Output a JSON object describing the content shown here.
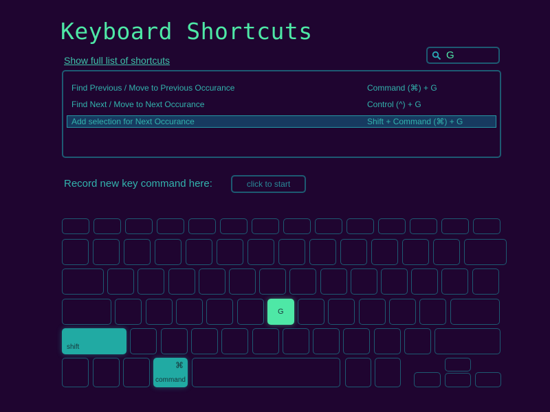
{
  "header": {
    "title": "Keyboard Shortcuts",
    "show_full_list_link": "Show full list of shortcuts"
  },
  "search": {
    "icon": "search-icon",
    "value": "G"
  },
  "shortcuts": [
    {
      "name": "Find Previous / Move to Previous Occurance",
      "keys": "Command (⌘) + G",
      "selected": false
    },
    {
      "name": "Find Next / Move to Next Occurance",
      "keys": "Control (^) + G",
      "selected": false
    },
    {
      "name": "Add selection for Next Occurance",
      "keys": "Shift + Command (⌘) + G",
      "selected": true
    }
  ],
  "record": {
    "label": "Record new  key command here:",
    "button_label": "click to start"
  },
  "keyboard": {
    "highlighted_keys": {
      "g": {
        "label": "G"
      },
      "shift": {
        "label": "shift"
      },
      "command": {
        "label": "command",
        "symbol": "⌘"
      }
    }
  },
  "colors": {
    "background": "#1f0530",
    "accent_green": "#4ee8a6",
    "accent_teal": "#21aaa3",
    "outline": "#1d5a72",
    "selection": "#173a60"
  }
}
